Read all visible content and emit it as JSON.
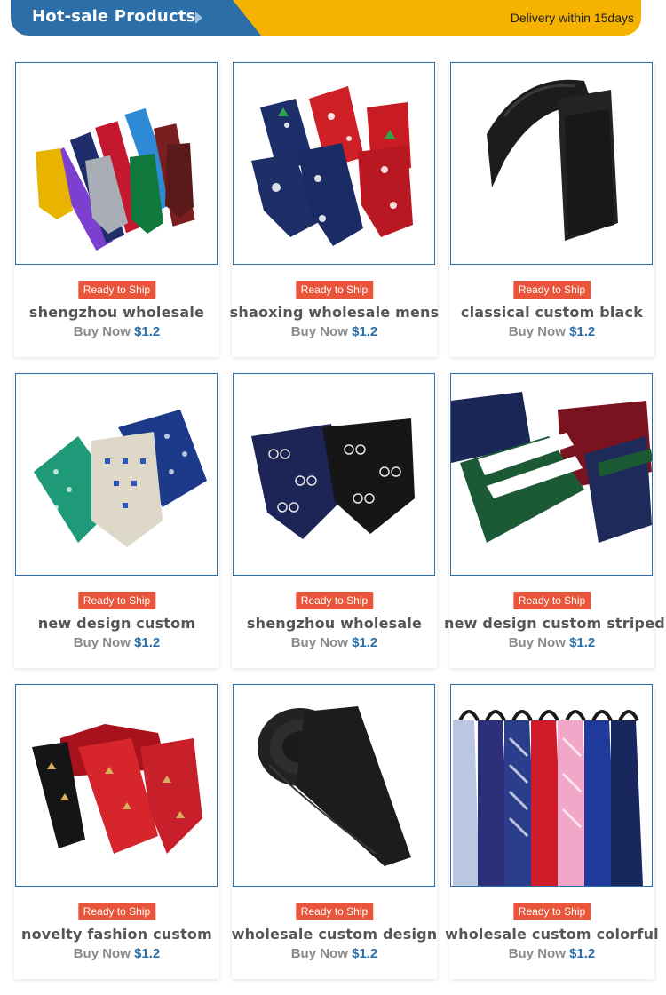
{
  "header": {
    "title": "Hot-sale Products",
    "delivery": "Delivery within 15days"
  },
  "colors": {
    "banner_blue": "#2c6fa8",
    "banner_yellow": "#f5b300",
    "badge_red": "#e8553a"
  },
  "products": [
    {
      "badge": "Ready to Ship",
      "name": "shengzhou wholesale",
      "buy": "Buy Now",
      "price": "$1.2",
      "image": "assorted-solid-color-ties"
    },
    {
      "badge": "Ready to Ship",
      "name": "shaoxing wholesale mens",
      "buy": "Buy Now",
      "price": "$1.2",
      "image": "christmas-pattern-ties"
    },
    {
      "badge": "Ready to Ship",
      "name": "classical custom black",
      "buy": "Buy Now",
      "price": "$1.2",
      "image": "black-skinny-ties"
    },
    {
      "badge": "Ready to Ship",
      "name": "new design custom",
      "buy": "Buy Now",
      "price": "$1.2",
      "image": "geometric-print-ties"
    },
    {
      "badge": "Ready to Ship",
      "name": "shengzhou wholesale",
      "buy": "Buy Now",
      "price": "$1.2",
      "image": "bicycle-print-ties"
    },
    {
      "badge": "Ready to Ship",
      "name": "new design custom striped",
      "buy": "Buy Now",
      "price": "$1.2",
      "image": "striped-ties"
    },
    {
      "badge": "Ready to Ship",
      "name": "novelty fashion custom",
      "buy": "Buy Now",
      "price": "$1.2",
      "image": "holiday-print-ties"
    },
    {
      "badge": "Ready to Ship",
      "name": "wholesale custom design",
      "buy": "Buy Now",
      "price": "$1.2",
      "image": "black-rolled-tie"
    },
    {
      "badge": "Ready to Ship",
      "name": "wholesale custom colorful",
      "buy": "Buy Now",
      "price": "$1.2",
      "image": "zipper-ties-hanging"
    }
  ]
}
